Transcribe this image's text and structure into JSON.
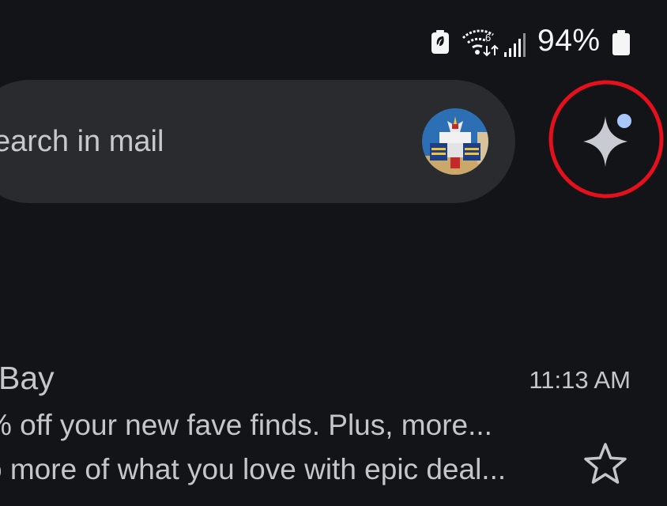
{
  "status_bar": {
    "battery_saver_icon": "battery-saver-icon",
    "wifi_icon": "wifi-6-icon",
    "signal_icon": "cell-signal-icon",
    "battery_percent": "94%",
    "battery_icon": "battery-icon"
  },
  "search": {
    "placeholder": "earch in mail"
  },
  "gemini": {
    "icon": "sparkle-icon",
    "highlight_color": "#e5101b",
    "dot_color": "#a8c7fa"
  },
  "email": {
    "sender": "Bay",
    "time": "11:13 AM",
    "subject": "% off your new fave finds. Plus, more...",
    "snippet": "o more of what you love with epic deal...",
    "star_icon": "star-outline-icon"
  }
}
